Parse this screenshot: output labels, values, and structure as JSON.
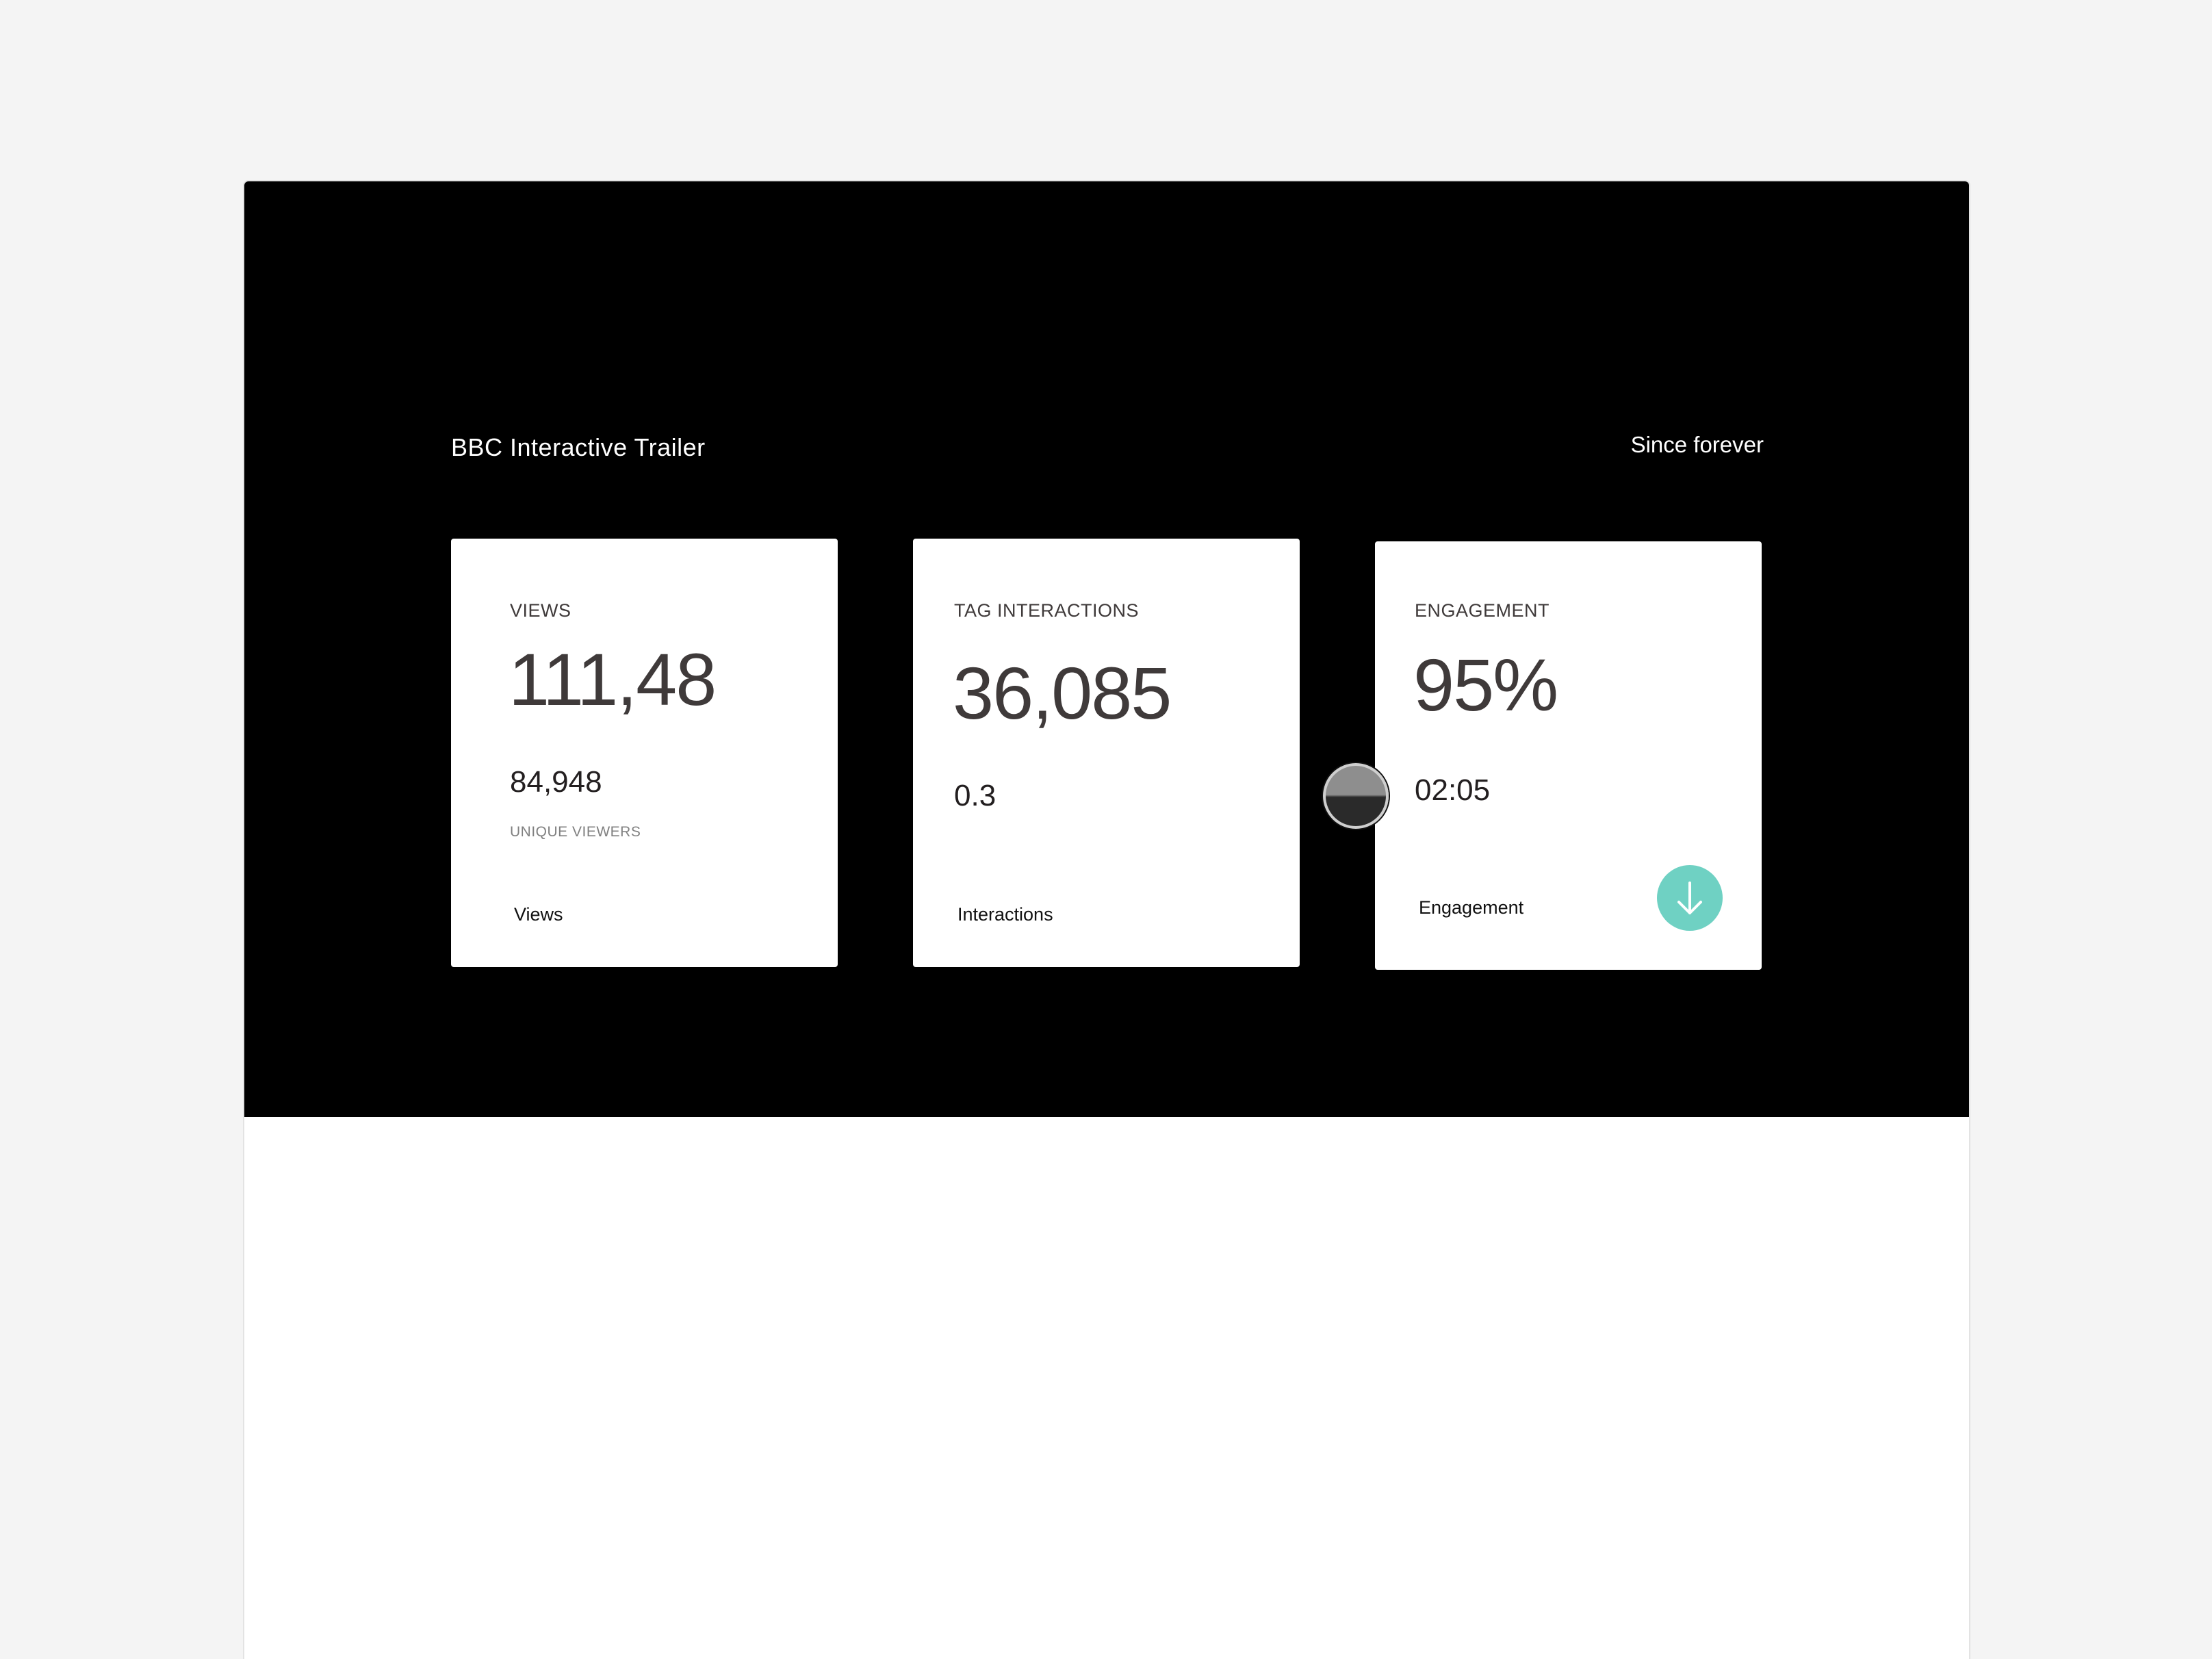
{
  "header": {
    "title": "BBC Interactive Trailer",
    "period": "Since forever"
  },
  "cards": [
    {
      "label": "VIEWS",
      "value": "111,48",
      "secondary": "84,948",
      "secondary_label": "UNIQUE VIEWERS",
      "link": "Views"
    },
    {
      "label": "TAG INTERACTIONS",
      "value": "36,085",
      "secondary": "0.3",
      "link": "Interactions"
    },
    {
      "label": "ENGAGEMENT",
      "value": "95%",
      "secondary": "02:05",
      "link": "Engagement",
      "action_icon": "arrow-down-icon"
    }
  ],
  "colors": {
    "hero_background": "#000000",
    "page_background": "#f4f4f4",
    "card_background": "#ffffff",
    "accent": "#6fd1c3",
    "primary_text": "#3f3a3a"
  }
}
